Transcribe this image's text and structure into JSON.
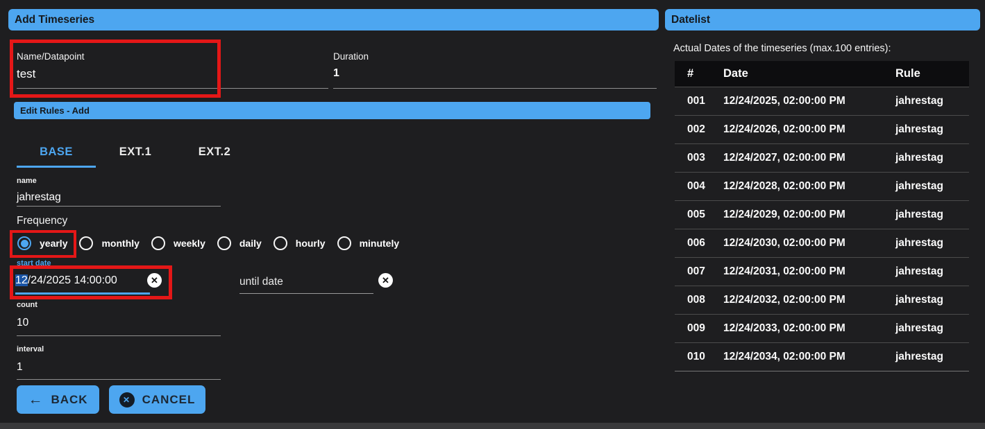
{
  "colors": {
    "accent": "#4da6f0",
    "annotation_red": "#e41717",
    "page_bg": "#1e1e20",
    "selection_blue": "#1a55a6",
    "table_header_bg": "#0d0d0f"
  },
  "left_panel": {
    "title": "Add Timeseries",
    "name_datapoint": {
      "label": "Name/Datapoint",
      "value": "test"
    },
    "duration": {
      "label": "Duration",
      "value": "1"
    },
    "edit_rules": {
      "title": "Edit Rules - Add",
      "tabs": [
        {
          "label": "BASE",
          "active": true
        },
        {
          "label": "EXT.1",
          "active": false
        },
        {
          "label": "EXT.2",
          "active": false
        }
      ],
      "rule_name": {
        "label": "name",
        "value": "jahrestag"
      },
      "frequency": {
        "label": "Frequency",
        "options": [
          "yearly",
          "monthly",
          "weekly",
          "daily",
          "hourly",
          "minutely"
        ],
        "selected": "yearly"
      },
      "start_date": {
        "label": "start date",
        "value_selected": "12",
        "value_rest": "/24/2025 14:00:00",
        "clear_icon": "x-circle"
      },
      "until_date": {
        "placeholder": "until date",
        "clear_icon": "x-circle"
      },
      "count": {
        "label": "count",
        "value": "10"
      },
      "interval": {
        "label": "interval",
        "value": "1"
      }
    },
    "buttons": {
      "back": "BACK",
      "cancel": "CANCEL",
      "back_icon": "left-arrow",
      "cancel_icon": "x-circle"
    }
  },
  "right_panel": {
    "title": "Datelist",
    "caption": "Actual Dates of the timeseries (max.100 entries):",
    "table": {
      "headers": [
        "#",
        "Date",
        "Rule"
      ],
      "rows": [
        [
          "001",
          "12/24/2025, 02:00:00 PM",
          "jahrestag"
        ],
        [
          "002",
          "12/24/2026, 02:00:00 PM",
          "jahrestag"
        ],
        [
          "003",
          "12/24/2027, 02:00:00 PM",
          "jahrestag"
        ],
        [
          "004",
          "12/24/2028, 02:00:00 PM",
          "jahrestag"
        ],
        [
          "005",
          "12/24/2029, 02:00:00 PM",
          "jahrestag"
        ],
        [
          "006",
          "12/24/2030, 02:00:00 PM",
          "jahrestag"
        ],
        [
          "007",
          "12/24/2031, 02:00:00 PM",
          "jahrestag"
        ],
        [
          "008",
          "12/24/2032, 02:00:00 PM",
          "jahrestag"
        ],
        [
          "009",
          "12/24/2033, 02:00:00 PM",
          "jahrestag"
        ],
        [
          "010",
          "12/24/2034, 02:00:00 PM",
          "jahrestag"
        ]
      ]
    }
  }
}
